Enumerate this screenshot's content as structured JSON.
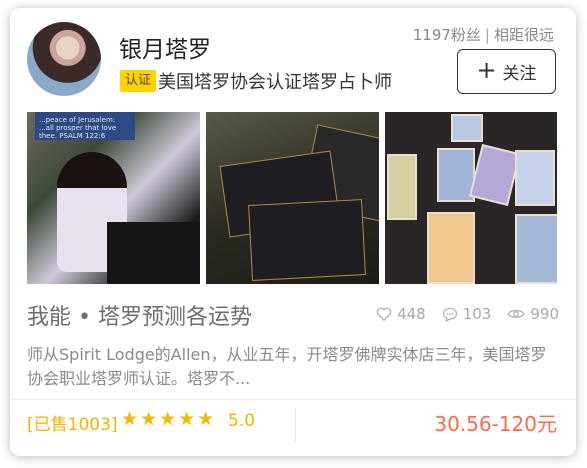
{
  "profile": {
    "name": "银月塔罗",
    "badge": "认证",
    "certification": "美国塔罗协会认证塔罗占卜师",
    "fans": "1197粉丝",
    "distance": "相距很远",
    "follow_label": "关注"
  },
  "service": {
    "title": "我能 • 塔罗预测各运势",
    "likes": "448",
    "comments": "103",
    "views": "990",
    "description": "师从Spirit Lodge的Allen，从业五年，开塔罗佛牌实体店三年，美国塔罗协会职业塔罗师认证。塔罗不...",
    "sold": "[已售1003]",
    "stars": "★★★★★",
    "rating": "5.0",
    "price": "30.56-120元"
  },
  "photos": {
    "banner_text": "...peace of Jerusalem: ...all prosper that love thee. PSALM 122:6"
  },
  "colors": {
    "accent": "#ffd200",
    "star": "#f5b800",
    "price": "#ff6a4d"
  },
  "icons": {
    "follow": "plus-icon",
    "likes": "heart-icon",
    "comments": "chat-icon",
    "views": "eye-icon"
  }
}
